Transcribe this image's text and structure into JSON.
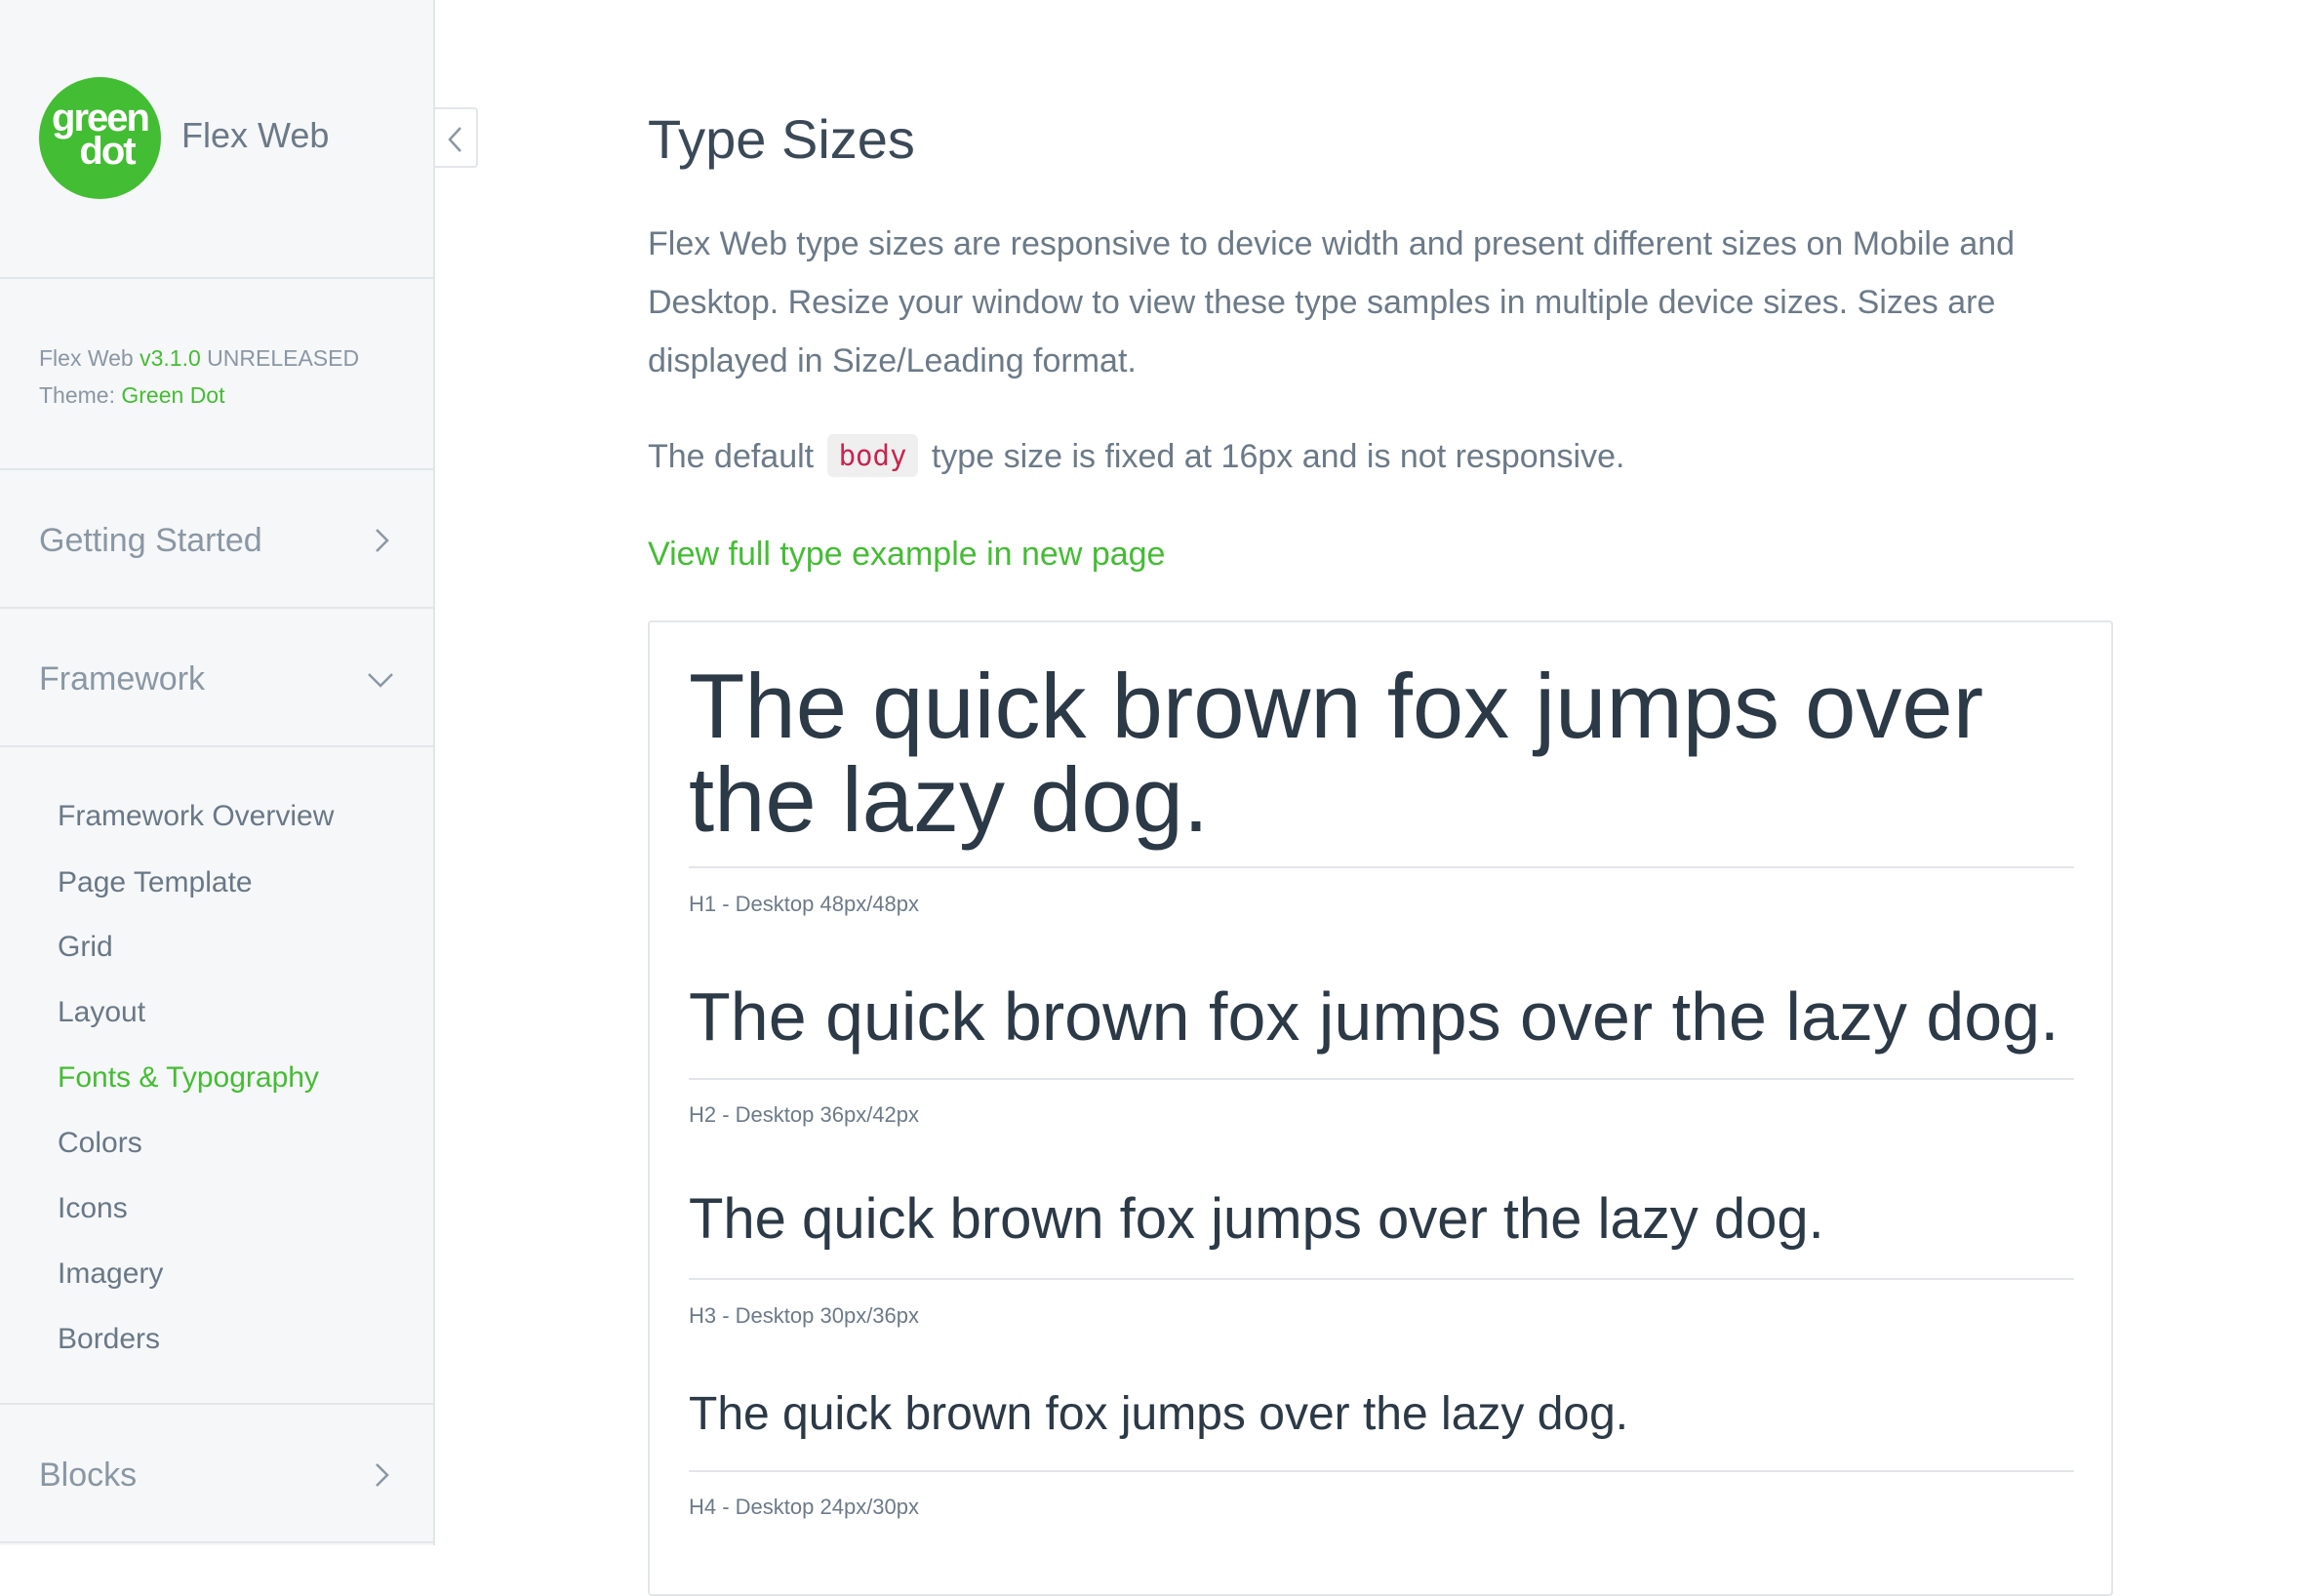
{
  "sidebar": {
    "logo": {
      "line1": "green",
      "line2": "dot",
      "color": "#43bd33"
    },
    "app_title": "Flex Web",
    "version": {
      "prefix": "Flex Web ",
      "number": "v3.1.0",
      "status": " UNRELEASED",
      "theme_label": "Theme: ",
      "theme_value": "Green Dot"
    },
    "sections": {
      "getting_started": "Getting Started",
      "framework": "Framework",
      "blocks": "Blocks"
    },
    "framework_items": [
      {
        "label": "Framework Overview"
      },
      {
        "label": "Page Template"
      },
      {
        "label": "Grid"
      },
      {
        "label": "Layout"
      },
      {
        "label": "Fonts & Typography",
        "active": true
      },
      {
        "label": "Colors"
      },
      {
        "label": "Icons"
      },
      {
        "label": "Imagery"
      },
      {
        "label": "Borders"
      }
    ]
  },
  "main": {
    "title": "Type Sizes",
    "intro": "Flex Web type sizes are responsive to device width and present different sizes on Mobile and Desktop. Resize your window to view these type samples in multiple device sizes. Sizes are displayed in Size/Leading format.",
    "default_prefix": "The default ",
    "default_code": "body",
    "default_suffix": " type size is fixed at 16px and is not responsive.",
    "link": "View full type example in new page",
    "samples": [
      {
        "text": "The quick brown fox jumps over the lazy dog.",
        "caption": "H1 - Desktop 48px/48px"
      },
      {
        "text": "The quick brown fox jumps over the lazy dog.",
        "caption": "H2 - Desktop 36px/42px"
      },
      {
        "text": "The quick brown fox jumps over the lazy dog.",
        "caption": "H3 - Desktop 30px/36px"
      },
      {
        "text": "The quick brown fox jumps over the lazy dog.",
        "caption": "H4 - Desktop 24px/30px"
      }
    ]
  },
  "icons": {
    "collapse": "chevron-left-icon",
    "getting_started": "chevron-right-icon",
    "framework": "chevron-down-icon",
    "blocks": "chevron-right-icon"
  },
  "colors": {
    "accent": "#43bd33",
    "code": "#c7254e",
    "sidebar_bg": "#f6f7f8",
    "border": "#e3e6e9"
  }
}
